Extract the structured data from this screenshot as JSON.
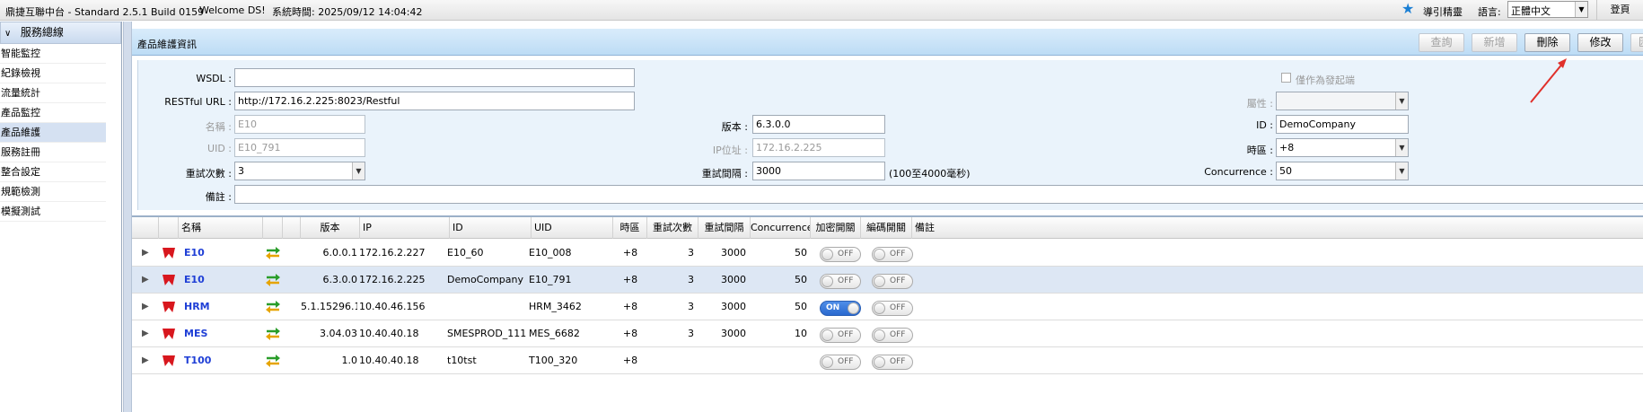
{
  "topbar": {
    "app_title": "鼎捷互聯中台 - Standard 2.5.1 Build 0159",
    "welcome": "Welcome DS!",
    "system_time": "系統時間: 2025/09/12 14:04:42",
    "guide": "導引精靈",
    "language_label": "語言:",
    "language_value": "正體中文",
    "home": "登頁"
  },
  "sidebar": {
    "header": "服務總線",
    "items": [
      {
        "label": "智能監控"
      },
      {
        "label": "紀錄檢視"
      },
      {
        "label": "流量統計"
      },
      {
        "label": "產品監控"
      },
      {
        "label": "產品維護",
        "active": true
      },
      {
        "label": "服務註冊"
      },
      {
        "label": "整合設定"
      },
      {
        "label": "規範檢測"
      },
      {
        "label": "模擬測試"
      }
    ]
  },
  "panel": {
    "title": "產品維護資訊",
    "buttons": {
      "query": "查詢",
      "add": "新增",
      "delete": "刪除",
      "edit": "修改",
      "export": "匯出"
    }
  },
  "form": {
    "wsdl_label": "WSDL :",
    "wsdl_value": "",
    "restful_label": "RESTful URL :",
    "restful_value": "http://172.16.2.225:8023/Restful",
    "name_label": "名稱 :",
    "name_value": "E10",
    "uid_label": "UID :",
    "uid_value": "E10_791",
    "retry_label": "重試次數 :",
    "retry_value": "3",
    "remark_label": "備註 :",
    "remark_value": "",
    "version_label": "版本 :",
    "version_value": "6.3.0.0",
    "ip_label": "IP位址 :",
    "ip_value": "172.16.2.225",
    "interval_label": "重試間隔 :",
    "interval_value": "3000",
    "interval_hint": "(100至4000毫秒)",
    "initiator_label": "僅作為發起端",
    "attribute_label": "屬性 :",
    "attribute_value": "",
    "id_label": "ID :",
    "id_value": "DemoCompany",
    "timezone_label": "時區 :",
    "timezone_value": "+8",
    "concurrence_label": "Concurrence :",
    "concurrence_value": "50"
  },
  "grid": {
    "headers": {
      "name": "名稱",
      "version": "版本",
      "ip": "IP",
      "id": "ID",
      "uid": "UID",
      "timezone": "時區",
      "retry": "重試次數",
      "interval": "重試間隔",
      "concurrence": "Concurrence",
      "encrypt": "加密開關",
      "encode": "編碼開關",
      "remark": "備註"
    },
    "rows": [
      {
        "name": "E10",
        "version": "6.0.0.1",
        "ip": "172.16.2.227",
        "id": "E10_60",
        "uid": "E10_008",
        "timezone": "+8",
        "retry": "3",
        "interval": "3000",
        "concurrence": "50",
        "encrypt": "OFF",
        "encode": "OFF",
        "selected": false
      },
      {
        "name": "E10",
        "version": "6.3.0.0",
        "ip": "172.16.2.225",
        "id": "DemoCompany",
        "uid": "E10_791",
        "timezone": "+8",
        "retry": "3",
        "interval": "3000",
        "concurrence": "50",
        "encrypt": "OFF",
        "encode": "OFF",
        "selected": true
      },
      {
        "name": "HRM",
        "version": "5.1.15296.1",
        "ip": "10.40.46.156",
        "id": "",
        "uid": "HRM_3462",
        "timezone": "+8",
        "retry": "3",
        "interval": "3000",
        "concurrence": "50",
        "encrypt": "ON",
        "encode": "OFF",
        "selected": false
      },
      {
        "name": "MES",
        "version": "3.04.03",
        "ip": "10.40.40.18",
        "id": "SMESPROD_111",
        "uid": "MES_6682",
        "timezone": "+8",
        "retry": "3",
        "interval": "3000",
        "concurrence": "10",
        "encrypt": "OFF",
        "encode": "OFF",
        "selected": false
      },
      {
        "name": "T100",
        "version": "1.0",
        "ip": "10.40.40.18",
        "id": "t10tst",
        "uid": "T100_320",
        "timezone": "+8",
        "retry": "",
        "interval": "",
        "concurrence": "",
        "encrypt": "OFF",
        "encode": "OFF",
        "selected": false
      }
    ]
  },
  "colors": {
    "accent": "#1a7fd4",
    "link": "#1f3fd6",
    "annotation_arrow": "#e0302b",
    "toggle_on": "#2a69cf"
  }
}
